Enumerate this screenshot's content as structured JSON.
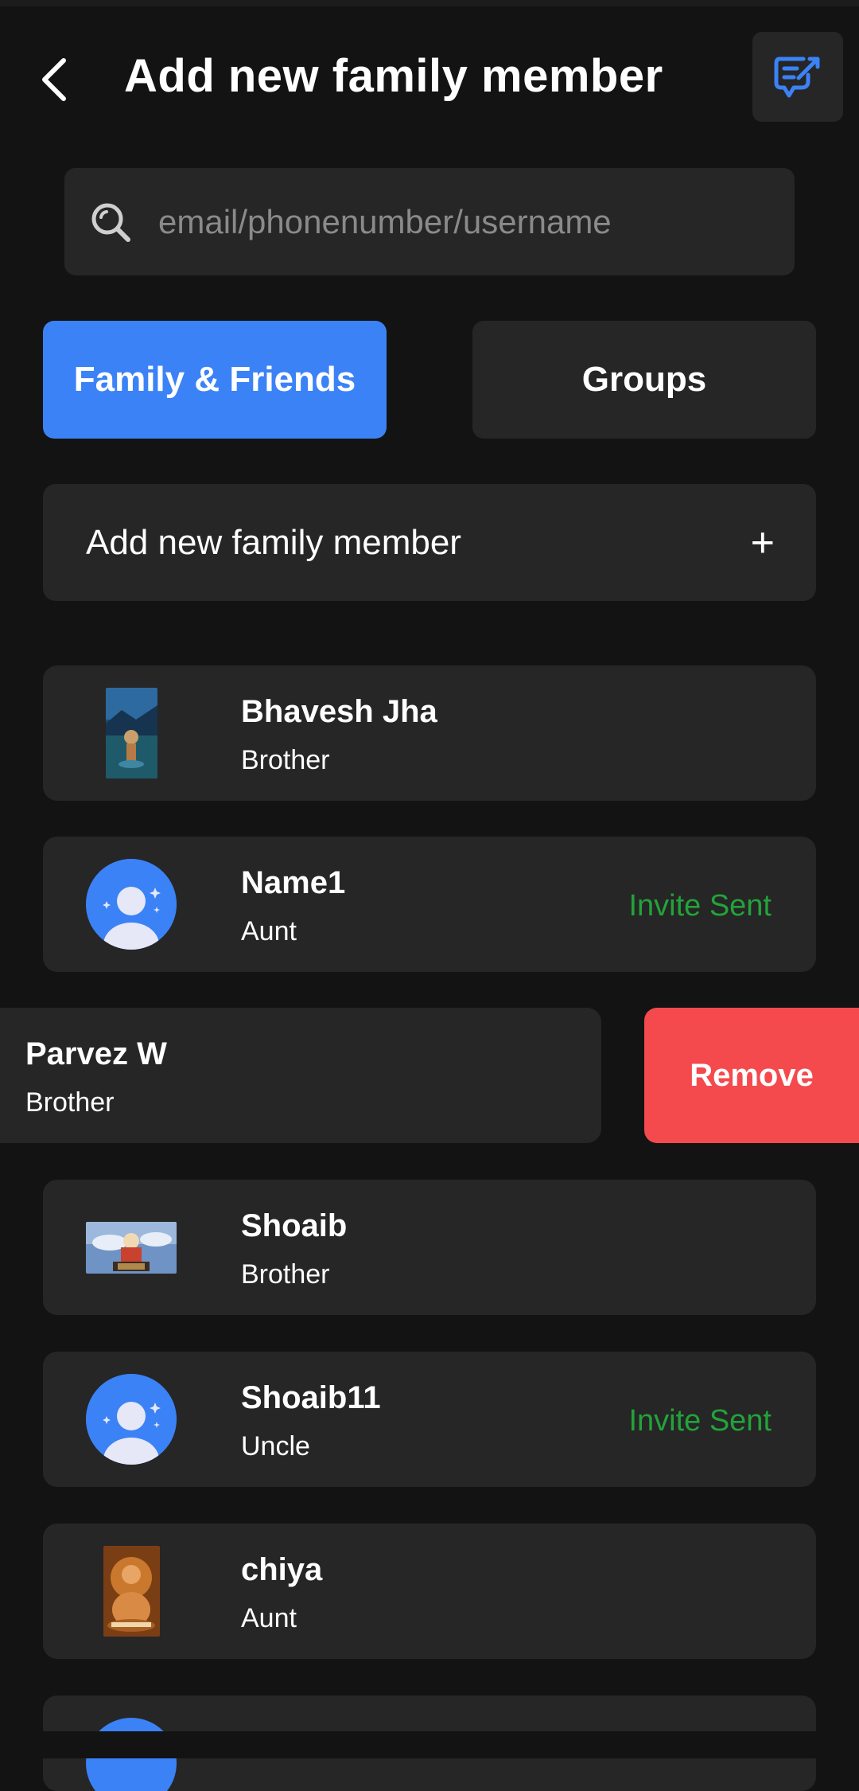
{
  "header": {
    "title": "Add new family member",
    "back_icon": "chevron-left-icon",
    "action_icon": "chat-edit-icon"
  },
  "search": {
    "placeholder": "email/phonenumber/username",
    "value": "",
    "icon": "search-icon"
  },
  "tabs": [
    {
      "label": "Family & Friends",
      "active": true
    },
    {
      "label": "Groups",
      "active": false
    }
  ],
  "add_member": {
    "label": "Add new family member",
    "icon": "+"
  },
  "members": [
    {
      "name": "Bhavesh Jha",
      "relation": "Brother",
      "status": "",
      "avatar": "photo-lake-figure"
    },
    {
      "name": "Name1",
      "relation": "Aunt",
      "status": "Invite Sent",
      "avatar": "default-person"
    },
    {
      "name": "Parvez W",
      "relation": "Brother",
      "status": "",
      "swiped": true,
      "action": "Remove"
    },
    {
      "name": "Shoaib",
      "relation": "Brother",
      "status": "",
      "avatar": "photo-anime-banner"
    },
    {
      "name": "Shoaib11",
      "relation": "Uncle",
      "status": "Invite Sent",
      "avatar": "default-person"
    },
    {
      "name": "chiya",
      "relation": "Aunt",
      "status": "",
      "avatar": "photo-buddha"
    }
  ],
  "colors": {
    "background": "#131313",
    "card": "#262626",
    "accent": "#3b82f6",
    "invite_status": "#22a33a",
    "remove": "#f44a4d"
  }
}
